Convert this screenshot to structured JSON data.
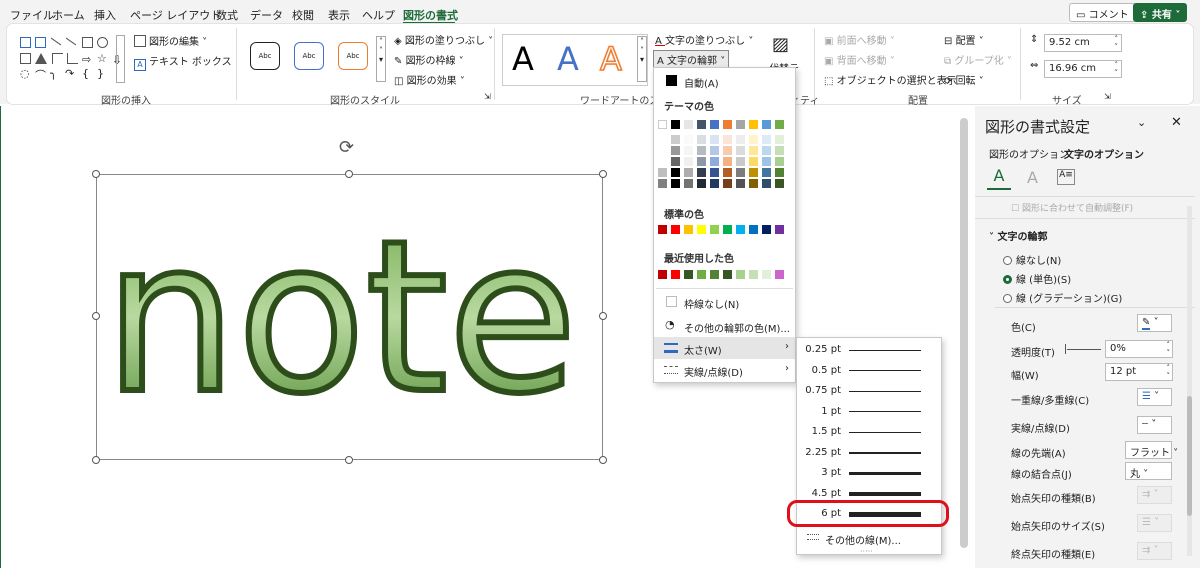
{
  "tabs": [
    "ファイル",
    "ホーム",
    "挿入",
    "ページ レイアウト",
    "数式",
    "データ",
    "校閲",
    "表示",
    "ヘルプ",
    "図形の書式"
  ],
  "active_tab": "図形の書式",
  "top_buttons": {
    "comment": "コメント",
    "share": "共有"
  },
  "ribbon": {
    "insert_shapes": {
      "edit_shape": "図形の編集",
      "text_box": "テキスト ボックス",
      "label": "図形の挿入"
    },
    "shape_styles": {
      "samples": [
        "Abc",
        "Abc",
        "Abc"
      ],
      "fill": "図形の塗りつぶし",
      "outline": "図形の枠線",
      "effects": "図形の効果",
      "label": "図形のスタイル"
    },
    "wordart": {
      "samples": [
        "A",
        "A",
        "A"
      ],
      "text_fill": "文字の塗りつぶし",
      "text_outline": "文字の輪郭",
      "label": "ワードアートのスタイル"
    },
    "alt_text": {
      "label": "代替テ",
      "group_label": "ィティ"
    },
    "arrange": {
      "forward": "前面へ移動",
      "backward": "背面へ移動",
      "selection": "オブジェクトの選択と表示",
      "align": "配置",
      "group": "グループ化",
      "rotate": "回転",
      "label": "配置"
    },
    "size": {
      "height": "9.52 cm",
      "width": "16.96 cm",
      "label": "サイズ"
    }
  },
  "canvas": {
    "wordart_text": "note"
  },
  "outline_menu": {
    "auto": "自動(A)",
    "theme_colors_header": "テーマの色",
    "standard_colors_header": "標準の色",
    "recent_colors_header": "最近使用した色",
    "no_outline": "枠線なし(N)",
    "more_colors": "その他の輪郭の色(M)...",
    "weight": "太さ(W)",
    "dashes": "実線/点線(D)",
    "theme_top": [
      "#ffffff",
      "#000000",
      "#e7e6e6",
      "#44546a",
      "#4472c4",
      "#ed7d31",
      "#a5a5a5",
      "#ffc000",
      "#5b9bd5",
      "#70ad47"
    ],
    "standard": [
      "#c00000",
      "#ff0000",
      "#ffc000",
      "#ffff00",
      "#92d050",
      "#00b050",
      "#00b0f0",
      "#0070c0",
      "#002060",
      "#7030a0"
    ],
    "recent": [
      "#c00000",
      "#ff0000",
      "#375623",
      "#70ad47",
      "#548235",
      "#375623",
      "#a9d18e",
      "#c5e0b4",
      "#e2efda",
      "#cc66cc"
    ]
  },
  "weight_menu": {
    "items": [
      {
        "label": "0.25 pt",
        "thickness": 0.25
      },
      {
        "label": "0.5 pt",
        "thickness": 0.5
      },
      {
        "label": "0.75 pt",
        "thickness": 0.75
      },
      {
        "label": "1 pt",
        "thickness": 1
      },
      {
        "label": "1.5 pt",
        "thickness": 1.5
      },
      {
        "label": "2.25 pt",
        "thickness": 2.25
      },
      {
        "label": "3 pt",
        "thickness": 3
      },
      {
        "label": "4.5 pt",
        "thickness": 4.5
      },
      {
        "label": "6 pt",
        "thickness": 6
      }
    ],
    "more_lines": "その他の線(M)...",
    "highlighted": "6 pt"
  },
  "pane": {
    "title": "図形の書式設定",
    "tab_shape": "図形のオプション",
    "tab_text": "文字のオプション",
    "section": "文字の輪郭",
    "radio_none": "線なし(N)",
    "radio_solid": "線 (単色)(S)",
    "radio_gradient": "線 (グラデーション)(G)",
    "color": "色(C)",
    "transparency": "透明度(T)",
    "transparency_val": "0%",
    "width": "幅(W)",
    "width_val": "12 pt",
    "compound": "一重線/多重線(C)",
    "dash": "実線/点線(D)",
    "cap": "線の先端(A)",
    "cap_val": "フラット",
    "join": "線の結合点(J)",
    "join_val": "丸",
    "begin_arrow_type": "始点矢印の種類(B)",
    "begin_arrow_size": "始点矢印のサイズ(S)",
    "end_arrow_type": "終点矢印の種類(E)",
    "faded_text": "図形に合わせて自動調整(F)"
  }
}
